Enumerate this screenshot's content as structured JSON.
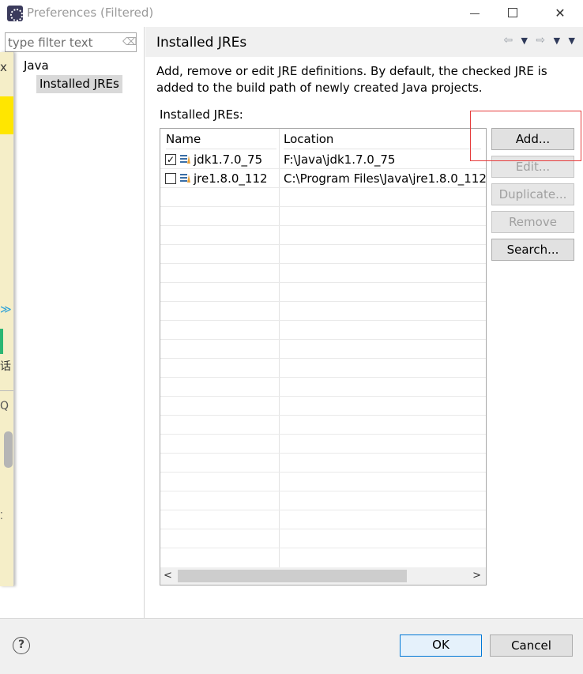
{
  "window": {
    "title": "Preferences (Filtered)",
    "minimize_icon": "minimize-icon",
    "maximize_icon": "maximize-icon",
    "close_icon": "close-icon",
    "close_glyph": "✕"
  },
  "sidebar": {
    "filter_placeholder": "type filter text",
    "clear_glyph": "⌫",
    "tree": {
      "root": "Java",
      "child": "Installed JREs"
    }
  },
  "overlay_strip": {
    "x_glyph": "x",
    "chevron_glyph": "≫",
    "char": "话",
    "q_glyph": "Q",
    "dot_glyph": "⁚"
  },
  "page": {
    "title": "Installed JREs",
    "nav": {
      "back_glyph": "⇦",
      "back_menu_glyph": "▼",
      "forward_glyph": "⇨",
      "forward_menu_glyph": "▼",
      "view_menu_glyph": "▼"
    },
    "description": "Add, remove or edit JRE definitions. By default, the checked JRE is added to the build path of newly created Java projects.",
    "table_label": "Installed JREs:",
    "table": {
      "columns": [
        "Name",
        "Location"
      ],
      "rows": [
        {
          "checked": true,
          "check_glyph": "✓",
          "name": "jdk1.7.0_75",
          "location": "F:\\Java\\jdk1.7.0_75"
        },
        {
          "checked": false,
          "check_glyph": "",
          "name": "jre1.8.0_112",
          "location": "C:\\Program Files\\Java\\jre1.8.0_112"
        }
      ],
      "scroll_left_glyph": "<",
      "scroll_right_glyph": ">"
    },
    "buttons": {
      "add": "Add...",
      "edit": "Edit...",
      "duplicate": "Duplicate...",
      "remove": "Remove",
      "search": "Search..."
    }
  },
  "footer": {
    "help_glyph": "?",
    "ok": "OK",
    "cancel": "Cancel"
  },
  "colors": {
    "accent": "#0078d7",
    "highlight": "#e63b3b",
    "header_bg": "#f0f0f0"
  }
}
